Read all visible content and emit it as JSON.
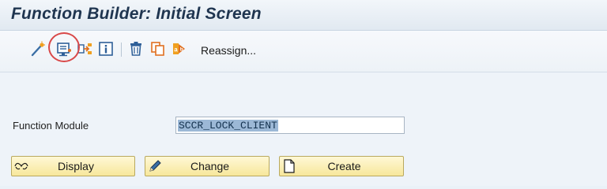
{
  "window": {
    "title": "Function Builder: Initial Screen"
  },
  "toolbar": {
    "icons": [
      {
        "name": "wand-icon"
      },
      {
        "name": "function-module-test-icon",
        "highlighted": true
      },
      {
        "name": "where-used-icon"
      },
      {
        "name": "info-icon"
      },
      {
        "name": "delete-icon"
      },
      {
        "name": "copy-icon"
      },
      {
        "name": "rename-icon"
      }
    ],
    "reassign_label": "Reassign..."
  },
  "form": {
    "function_module_label": "Function Module",
    "function_module_value": "SCCR_LOCK_CLIENT"
  },
  "buttons": {
    "display_label": "Display",
    "change_label": "Change",
    "create_label": "Create"
  },
  "colors": {
    "highlight_circle": "#d94848",
    "button_fill": "#f7e79b",
    "title_text": "#1f3550"
  }
}
